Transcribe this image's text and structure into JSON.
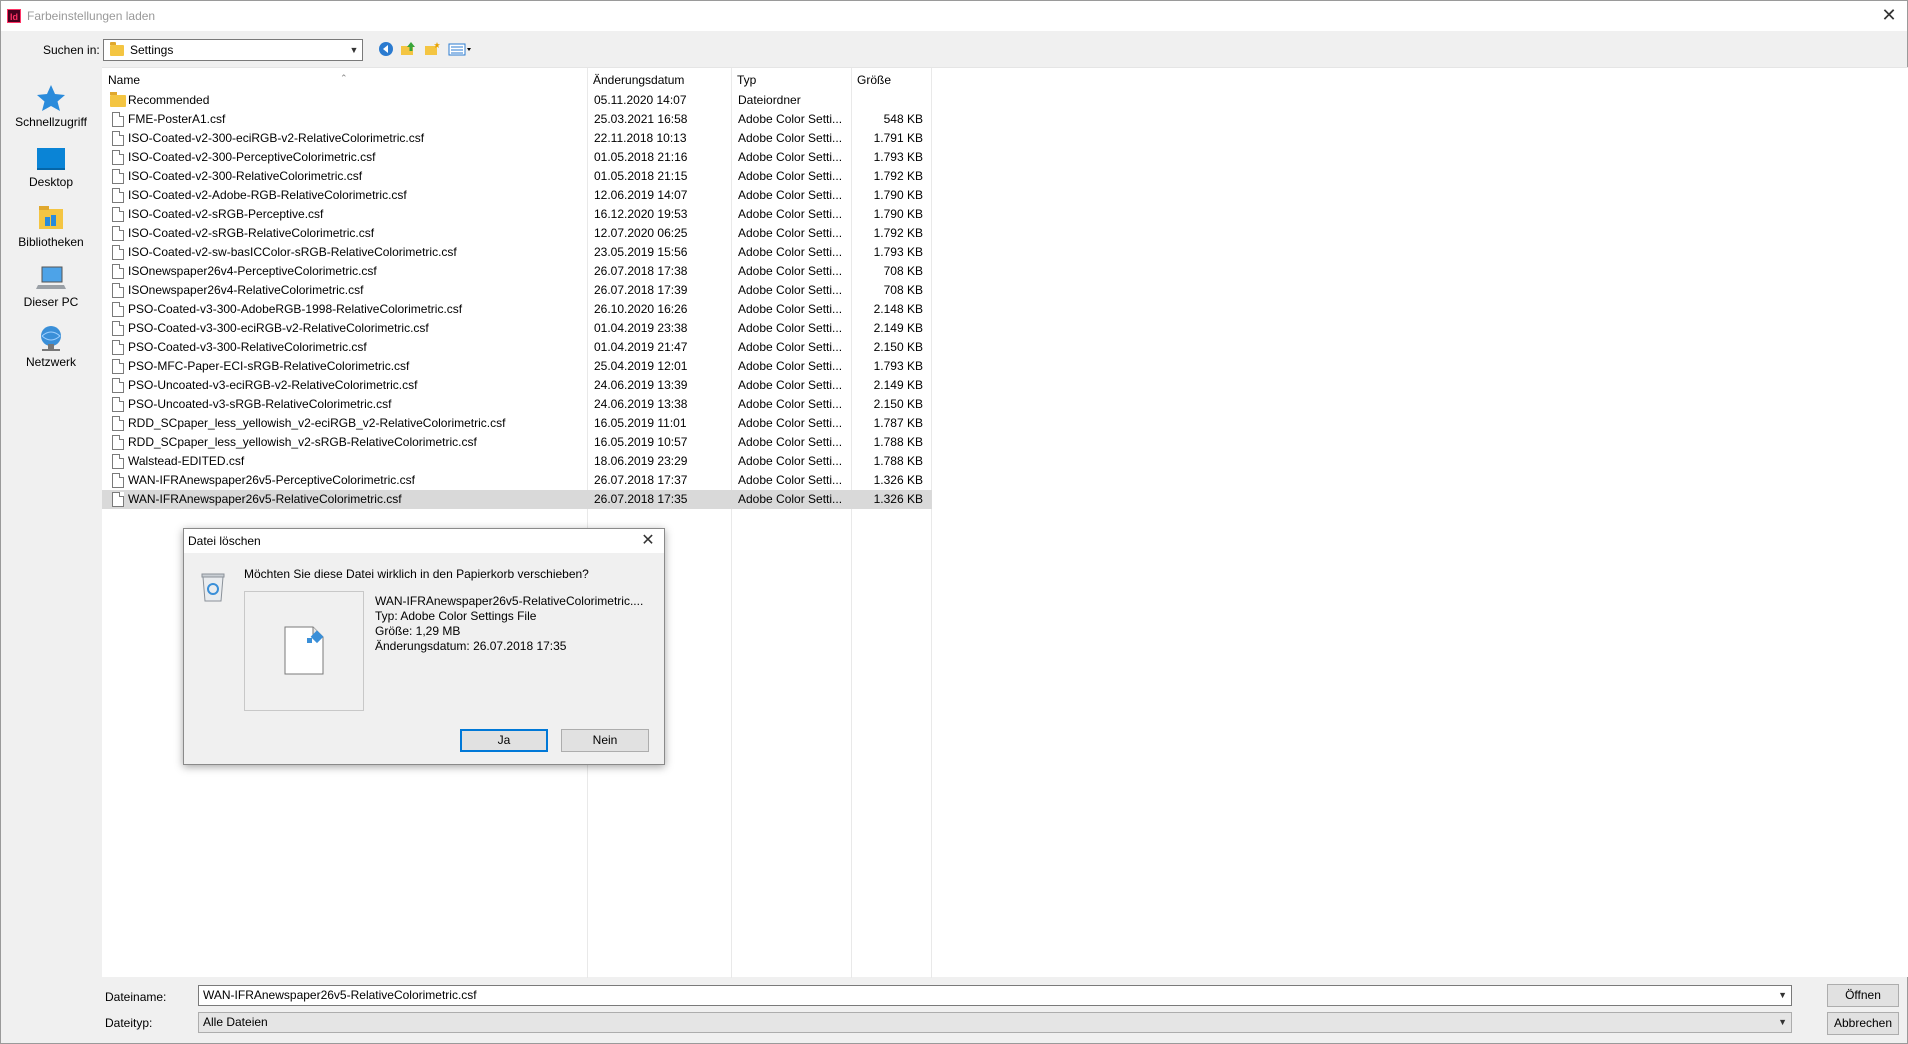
{
  "window": {
    "app_icon": "indesign-app-icon",
    "app_icon_text": "Id",
    "title": "Farbeinstellungen laden",
    "close_glyph": "✕"
  },
  "lookin": {
    "label": "Suchen in:",
    "value": "Settings"
  },
  "places": [
    {
      "label": "Schnellzugriff",
      "icon": "star-icon"
    },
    {
      "label": "Desktop",
      "icon": "desktop-icon"
    },
    {
      "label": "Bibliotheken",
      "icon": "library-icon"
    },
    {
      "label": "Dieser PC",
      "icon": "computer-icon"
    },
    {
      "label": "Netzwerk",
      "icon": "network-icon"
    }
  ],
  "columns": {
    "name": "Name",
    "date": "Änderungsdatum",
    "type": "Typ",
    "size": "Größe"
  },
  "files": [
    {
      "name": "Recommended",
      "date": "05.11.2020 14:07",
      "type": "Dateiordner",
      "size": "",
      "folder": true
    },
    {
      "name": "FME-PosterA1.csf",
      "date": "25.03.2021 16:58",
      "type": "Adobe Color Setti...",
      "size": "548 KB"
    },
    {
      "name": "ISO-Coated-v2-300-eciRGB-v2-RelativeColorimetric.csf",
      "date": "22.11.2018 10:13",
      "type": "Adobe Color Setti...",
      "size": "1.791 KB"
    },
    {
      "name": "ISO-Coated-v2-300-PerceptiveColorimetric.csf",
      "date": "01.05.2018 21:16",
      "type": "Adobe Color Setti...",
      "size": "1.793 KB"
    },
    {
      "name": "ISO-Coated-v2-300-RelativeColorimetric.csf",
      "date": "01.05.2018 21:15",
      "type": "Adobe Color Setti...",
      "size": "1.792 KB"
    },
    {
      "name": "ISO-Coated-v2-Adobe-RGB-RelativeColorimetric.csf",
      "date": "12.06.2019 14:07",
      "type": "Adobe Color Setti...",
      "size": "1.790 KB"
    },
    {
      "name": "ISO-Coated-v2-sRGB-Perceptive.csf",
      "date": "16.12.2020 19:53",
      "type": "Adobe Color Setti...",
      "size": "1.790 KB"
    },
    {
      "name": "ISO-Coated-v2-sRGB-RelativeColorimetric.csf",
      "date": "12.07.2020 06:25",
      "type": "Adobe Color Setti...",
      "size": "1.792 KB"
    },
    {
      "name": "ISO-Coated-v2-sw-basICColor-sRGB-RelativeColorimetric.csf",
      "date": "23.05.2019 15:56",
      "type": "Adobe Color Setti...",
      "size": "1.793 KB"
    },
    {
      "name": "ISOnewspaper26v4-PerceptiveColorimetric.csf",
      "date": "26.07.2018 17:38",
      "type": "Adobe Color Setti...",
      "size": "708 KB"
    },
    {
      "name": "ISOnewspaper26v4-RelativeColorimetric.csf",
      "date": "26.07.2018 17:39",
      "type": "Adobe Color Setti...",
      "size": "708 KB"
    },
    {
      "name": "PSO-Coated-v3-300-AdobeRGB-1998-RelativeColorimetric.csf",
      "date": "26.10.2020 16:26",
      "type": "Adobe Color Setti...",
      "size": "2.148 KB"
    },
    {
      "name": "PSO-Coated-v3-300-eciRGB-v2-RelativeColorimetric.csf",
      "date": "01.04.2019 23:38",
      "type": "Adobe Color Setti...",
      "size": "2.149 KB"
    },
    {
      "name": "PSO-Coated-v3-300-RelativeColorimetric.csf",
      "date": "01.04.2019 21:47",
      "type": "Adobe Color Setti...",
      "size": "2.150 KB"
    },
    {
      "name": "PSO-MFC-Paper-ECI-sRGB-RelativeColorimetric.csf",
      "date": "25.04.2019 12:01",
      "type": "Adobe Color Setti...",
      "size": "1.793 KB"
    },
    {
      "name": "PSO-Uncoated-v3-eciRGB-v2-RelativeColorimetric.csf",
      "date": "24.06.2019 13:39",
      "type": "Adobe Color Setti...",
      "size": "2.149 KB"
    },
    {
      "name": "PSO-Uncoated-v3-sRGB-RelativeColorimetric.csf",
      "date": "24.06.2019 13:38",
      "type": "Adobe Color Setti...",
      "size": "2.150 KB"
    },
    {
      "name": "RDD_SCpaper_less_yellowish_v2-eciRGB_v2-RelativeColorimetric.csf",
      "date": "16.05.2019 11:01",
      "type": "Adobe Color Setti...",
      "size": "1.787 KB"
    },
    {
      "name": "RDD_SCpaper_less_yellowish_v2-sRGB-RelativeColorimetric.csf",
      "date": "16.05.2019 10:57",
      "type": "Adobe Color Setti...",
      "size": "1.788 KB"
    },
    {
      "name": "Walstead-EDITED.csf",
      "date": "18.06.2019 23:29",
      "type": "Adobe Color Setti...",
      "size": "1.788 KB"
    },
    {
      "name": "WAN-IFRAnewspaper26v5-PerceptiveColorimetric.csf",
      "date": "26.07.2018 17:37",
      "type": "Adobe Color Setti...",
      "size": "1.326 KB"
    },
    {
      "name": "WAN-IFRAnewspaper26v5-RelativeColorimetric.csf",
      "date": "26.07.2018 17:35",
      "type": "Adobe Color Setti...",
      "size": "1.326 KB",
      "selected": true
    }
  ],
  "bottom": {
    "filename_label": "Dateiname:",
    "filename_value": "WAN-IFRAnewspaper26v5-RelativeColorimetric.csf",
    "filetype_label": "Dateityp:",
    "filetype_value": "Alle Dateien",
    "open_button": "Öffnen",
    "cancel_button": "Abbrechen"
  },
  "dialog": {
    "title": "Datei löschen",
    "question": "Möchten Sie diese Datei wirklich in den Papierkorb verschieben?",
    "file_name": "WAN-IFRAnewspaper26v5-RelativeColorimetric....",
    "file_type": "Typ: Adobe Color Settings File",
    "file_size": "Größe: 1,29 MB",
    "file_date": "Änderungsdatum: 26.07.2018 17:35",
    "yes_button": "Ja",
    "no_button": "Nein"
  },
  "colors": {
    "accent": "#0078d7",
    "selection": "#d9d9d9",
    "folder": "#f4c542"
  }
}
